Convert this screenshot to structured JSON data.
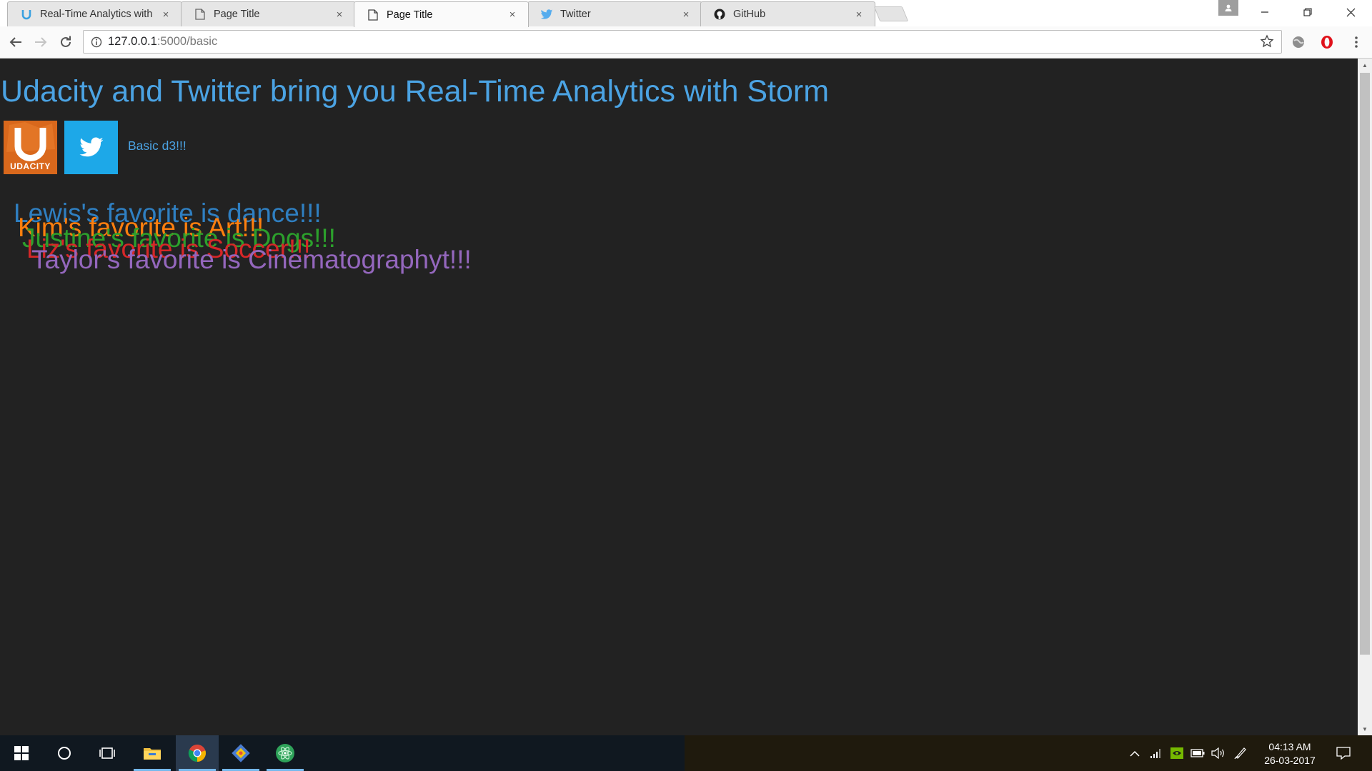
{
  "browser": {
    "tabs": [
      {
        "title": "Real-Time Analytics with",
        "favicon": "udacity-icon"
      },
      {
        "title": "Page Title",
        "favicon": "page-icon"
      },
      {
        "title": "Page Title",
        "favicon": "page-icon",
        "active": true
      },
      {
        "title": "Twitter",
        "favicon": "twitter-icon"
      },
      {
        "title": "GitHub",
        "favicon": "github-icon"
      }
    ],
    "tab_close": "×",
    "url_host": "127.0.0.1",
    "url_path": ":5000/basic"
  },
  "page": {
    "title": "Udacity and Twitter bring you Real-Time Analytics with Storm",
    "udacity_logo_text": "UDACITY",
    "basic_link": "Basic d3!!!",
    "favorites": [
      {
        "text": "Lewis's favorite is dance!!!",
        "color": "#2f7fc1"
      },
      {
        "text": "Kim's favorite is Art!!!",
        "color": "#ff7f0e"
      },
      {
        "text": "Justine's favorite is Dogs!!!",
        "color": "#2ca02c"
      },
      {
        "text": "Liz's favorite is Soccer!!!",
        "color": "#d62728"
      },
      {
        "text": "Taylor's favorite is Cinematographyt!!!",
        "color": "#9467bd"
      }
    ]
  },
  "taskbar": {
    "clock_time": "04:13 AM",
    "clock_date": "26-03-2017"
  },
  "colors": {
    "page_background": "#222222",
    "title_blue": "#4ba3e3",
    "udacity_orange": "#e06f1f",
    "twitter_blue": "#1da8e8"
  }
}
